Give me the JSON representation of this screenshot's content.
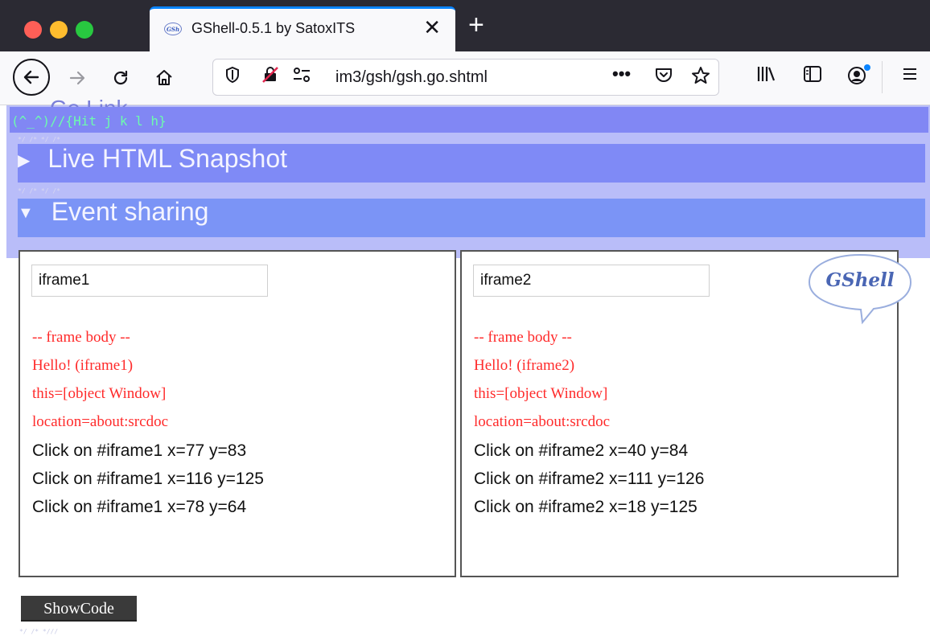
{
  "browser": {
    "tab_title": "GShell-0.5.1 by SatoxITS",
    "tab_favicon_text": "GSh",
    "close_tab": "✕",
    "new_tab": "+",
    "url": "im3/gsh/gsh.go.shtml",
    "accent_color": "#0a84ff"
  },
  "page": {
    "hit_text": "(^_^)//{Hit j k l h}",
    "ghost_heading": "Go Link",
    "section_live": "Live HTML Snapshot",
    "section_event": "Event sharing",
    "mark1": "*/ /* */ /*",
    "mark2": "*/ /* */ /*",
    "bottom_mark": "*/ /* *///",
    "colors": {
      "strip": "#b9bdf9",
      "bar": "#7f8af6",
      "hit_text": "#6dfcae",
      "red_text": "#ff2a2a"
    }
  },
  "iframe1": {
    "input_value": "iframe1",
    "body_lines": [
      "-- frame body --",
      "Hello! (iframe1)",
      "this=[object Window]",
      "location=about:srcdoc"
    ],
    "clicks": [
      "Click on #iframe1 x=77 y=83",
      "Click on #iframe1 x=116 y=125",
      "Click on #iframe1 x=78 y=64"
    ]
  },
  "iframe2": {
    "input_value": "iframe2",
    "body_lines": [
      "-- frame body --",
      "Hello! (iframe2)",
      "this=[object Window]",
      "location=about:srcdoc"
    ],
    "clicks": [
      "Click on #iframe2 x=40 y=84",
      "Click on #iframe2 x=111 y=126",
      "Click on #iframe2 x=18 y=125"
    ]
  },
  "logo_text": "GShell",
  "showcode_label": "ShowCode"
}
